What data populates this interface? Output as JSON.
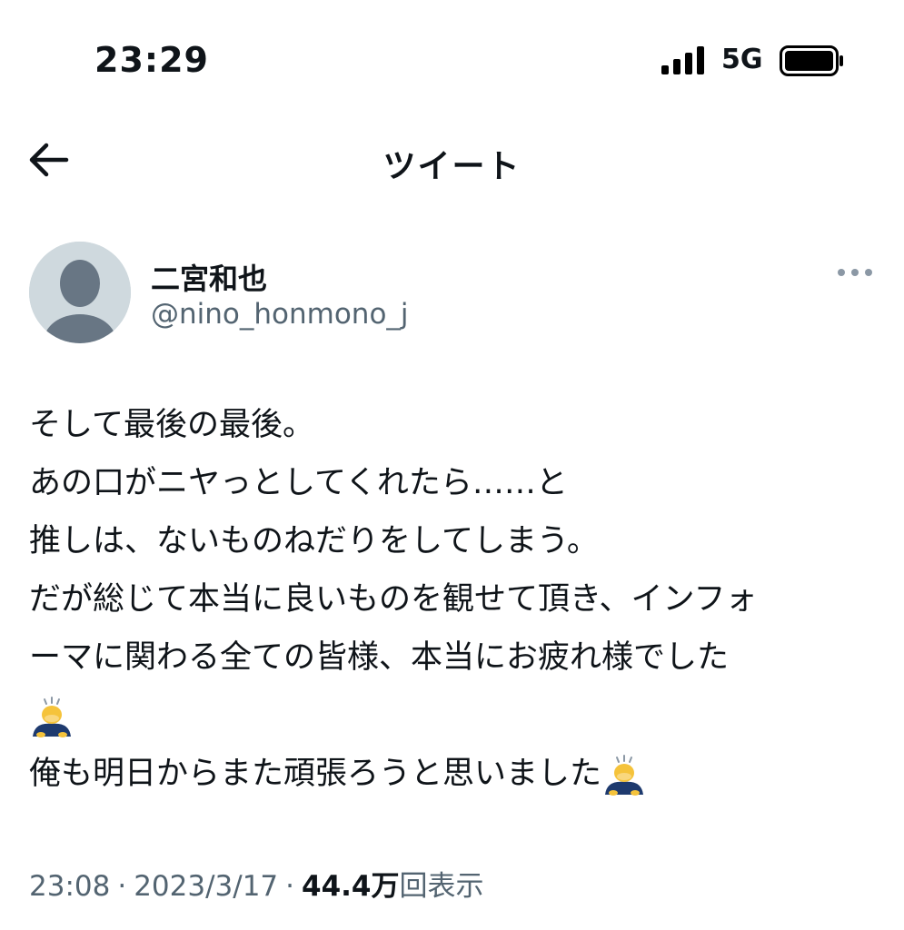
{
  "status_bar": {
    "time": "23:29",
    "network": "5G",
    "icons": [
      "signal-bars-icon",
      "battery-icon"
    ]
  },
  "nav": {
    "back_icon": "arrow-left-icon",
    "title": "ツイート"
  },
  "tweet": {
    "author": {
      "display_name": "二宮和也",
      "handle": "@nino_honmono_j",
      "avatar_icon": "default-avatar-icon"
    },
    "more_icon": "more-dots-icon",
    "lines": [
      "そして最後の最後。",
      "あの口がニヤっとしてくれたら……と",
      "推しは、ないものねだりをしてしまう。",
      "だが総じて本当に良いものを観せて頂き、インフォ",
      "ーマに関わる全ての皆様、本当にお疲れ様でした",
      "🙇",
      "俺も明日からまた頑張ろうと思いました"
    ],
    "emoji_icon": "person-bowing-icon",
    "meta": {
      "time": "23:08",
      "date": "2023/3/17",
      "separator": "·",
      "views_count": "44.4万",
      "views_label": "回表示"
    }
  },
  "colors": {
    "text": "#0f1419",
    "secondary": "#536471",
    "avatar_bg": "#cfd9de",
    "avatar_fg": "#687684"
  }
}
